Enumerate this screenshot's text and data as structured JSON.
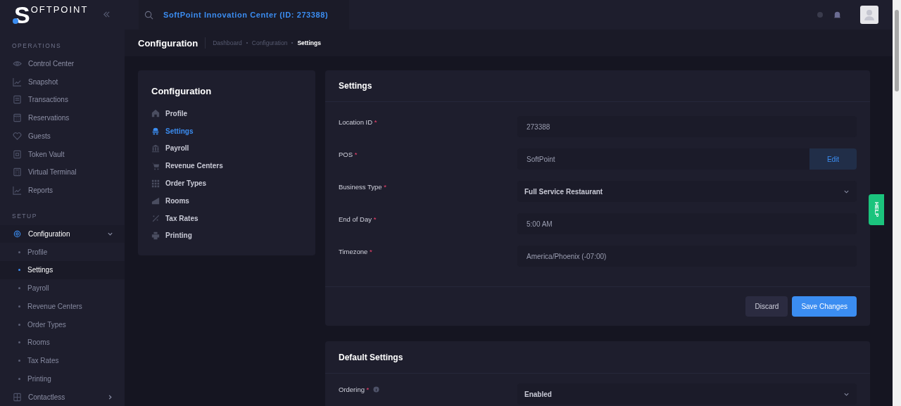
{
  "brand": {
    "letter": "S",
    "rest": "OFTPOINT"
  },
  "search": {
    "value": "SoftPoint Innovation Center (ID: 273388)"
  },
  "sidebar": {
    "sections": [
      {
        "title": "OPERATIONS",
        "items": [
          {
            "label": "Control Center",
            "selected": false
          },
          {
            "label": "Snapshot",
            "selected": false
          },
          {
            "label": "Transactions",
            "selected": false
          },
          {
            "label": "Reservations",
            "selected": false
          },
          {
            "label": "Guests",
            "selected": false
          },
          {
            "label": "Token Vault",
            "selected": false
          },
          {
            "label": "Virtual Terminal",
            "selected": false
          },
          {
            "label": "Reports",
            "selected": false
          }
        ]
      },
      {
        "title": "SETUP",
        "items": [
          {
            "label": "Configuration",
            "selected": true,
            "expanded": true,
            "children": [
              {
                "label": "Profile",
                "selected": false
              },
              {
                "label": "Settings",
                "selected": true
              },
              {
                "label": "Payroll",
                "selected": false
              },
              {
                "label": "Revenue Centers",
                "selected": false
              },
              {
                "label": "Order Types",
                "selected": false
              },
              {
                "label": "Rooms",
                "selected": false
              },
              {
                "label": "Tax Rates",
                "selected": false
              },
              {
                "label": "Printing",
                "selected": false
              }
            ]
          },
          {
            "label": "Contactless",
            "selected": false,
            "expanded": false
          }
        ]
      }
    ]
  },
  "page_header": {
    "title": "Configuration",
    "breadcrumbs": [
      "Dashboard",
      "Configuration",
      "Settings"
    ]
  },
  "config_menu": {
    "title": "Configuration",
    "items": [
      {
        "label": "Profile",
        "selected": false
      },
      {
        "label": "Settings",
        "selected": true
      },
      {
        "label": "Payroll",
        "selected": false
      },
      {
        "label": "Revenue Centers",
        "selected": false
      },
      {
        "label": "Order Types",
        "selected": false
      },
      {
        "label": "Rooms",
        "selected": false
      },
      {
        "label": "Tax Rates",
        "selected": false
      },
      {
        "label": "Printing",
        "selected": false
      }
    ]
  },
  "settings_card": {
    "title": "Settings",
    "fields": [
      {
        "label": "Location ID",
        "mark": "*",
        "kind": "text",
        "value": "273388"
      },
      {
        "label": "POS",
        "mark": "*",
        "kind": "text_button",
        "value": "SoftPoint",
        "button": "Edit"
      },
      {
        "label": "Business Type",
        "mark": "*",
        "kind": "select",
        "value": "Full Service Restaurant"
      },
      {
        "label": "End of Day",
        "mark": "*",
        "kind": "text",
        "value": "5:00 AM"
      },
      {
        "label": "Timezone",
        "mark": "*",
        "kind": "text",
        "value": "America/Phoenix (-07:00)"
      }
    ],
    "buttons": {
      "discard": "Discard",
      "save": "Save Changes"
    }
  },
  "default_card": {
    "title": "Default Settings",
    "fields": [
      {
        "label": "Ordering",
        "mark": "*",
        "info": true,
        "kind": "select",
        "value": "Enabled"
      }
    ]
  },
  "help_tab": "HELP"
}
